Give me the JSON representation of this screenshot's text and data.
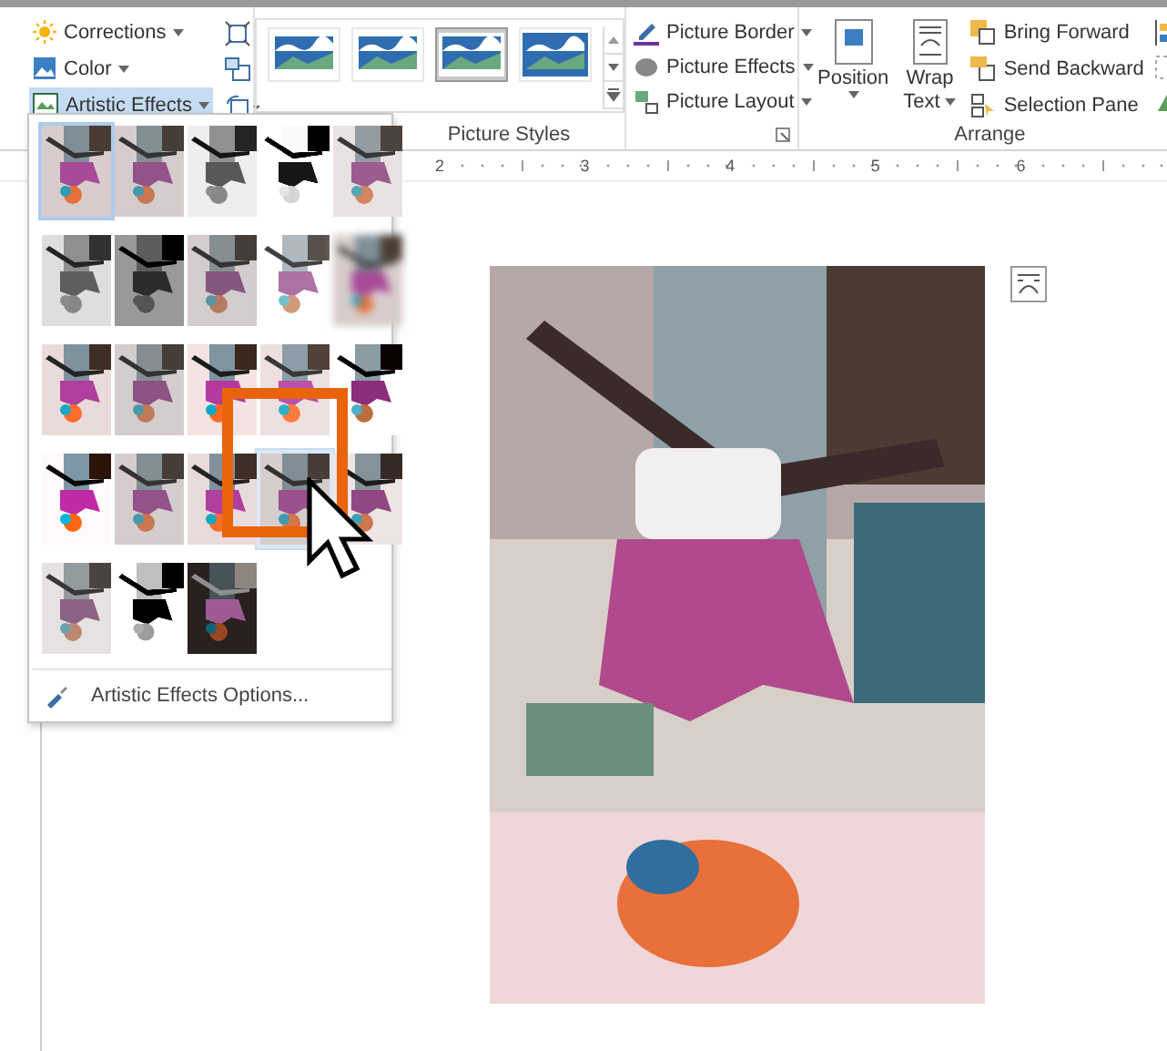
{
  "ribbon": {
    "adjust": [
      {
        "label": "Corrections",
        "open": false
      },
      {
        "label": "Color",
        "open": false
      },
      {
        "label": "Artistic Effects",
        "open": true
      }
    ],
    "styles": [
      {
        "selected": false
      },
      {
        "selected": false
      },
      {
        "selected": true
      },
      {
        "selected": false
      }
    ],
    "styles_label": "Picture Styles",
    "format": [
      {
        "label": "Picture Border"
      },
      {
        "label": "Picture Effects"
      },
      {
        "label": "Picture Layout"
      }
    ],
    "position": "Position",
    "wrap": [
      "Wrap",
      "Text"
    ],
    "order": [
      {
        "label": "Bring Forward"
      },
      {
        "label": "Send Backward"
      },
      {
        "label": "Selection Pane"
      }
    ],
    "arrange_label": "Arrange"
  },
  "ruler": [
    "2",
    "3",
    "4",
    "5",
    "6"
  ],
  "gallery": {
    "effects": [
      {
        "selected": true,
        "hovered": false
      },
      {
        "selected": false,
        "hovered": false
      },
      {
        "selected": false,
        "hovered": false
      },
      {
        "selected": false,
        "hovered": false
      },
      {
        "selected": false,
        "hovered": false
      },
      {
        "selected": false,
        "hovered": false
      },
      {
        "selected": false,
        "hovered": false
      },
      {
        "selected": false,
        "hovered": false
      },
      {
        "selected": false,
        "hovered": false
      },
      {
        "selected": false,
        "hovered": false
      },
      {
        "selected": false,
        "hovered": false
      },
      {
        "selected": false,
        "hovered": false
      },
      {
        "selected": false,
        "hovered": false
      },
      {
        "selected": false,
        "hovered": false
      },
      {
        "selected": false,
        "hovered": false
      },
      {
        "selected": false,
        "hovered": false
      },
      {
        "selected": false,
        "hovered": false
      },
      {
        "selected": false,
        "hovered": false
      },
      {
        "selected": false,
        "hovered": true
      },
      {
        "selected": false,
        "hovered": false
      },
      {
        "selected": false,
        "hovered": false
      },
      {
        "selected": false,
        "hovered": false
      },
      {
        "selected": false,
        "hovered": false
      }
    ],
    "options": "Artistic Effects Options..."
  }
}
